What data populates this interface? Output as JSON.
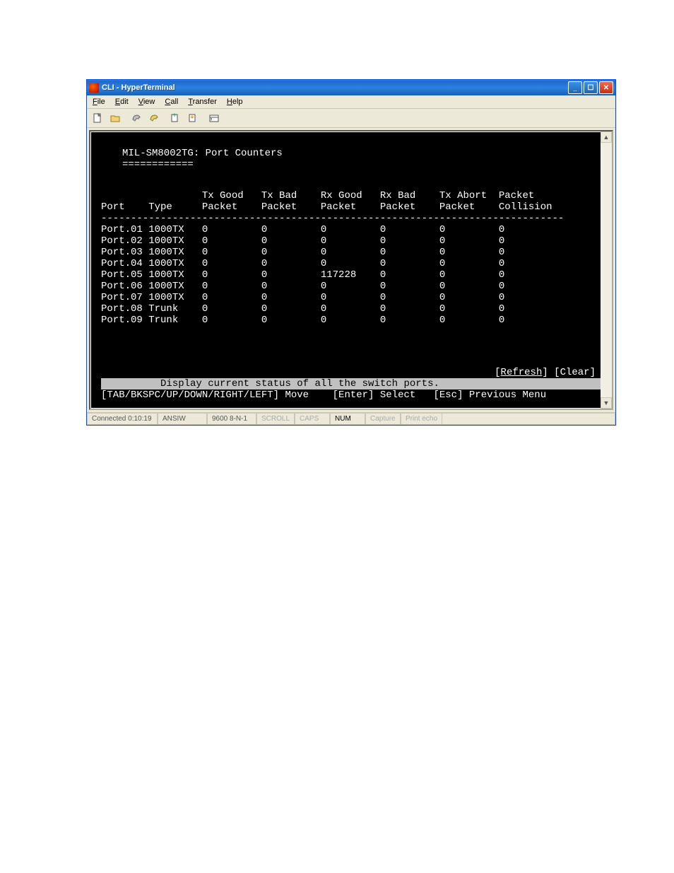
{
  "window": {
    "title": "CLI - HyperTerminal"
  },
  "menubar": [
    {
      "underline": "F",
      "rest": "ile"
    },
    {
      "underline": "E",
      "rest": "dit"
    },
    {
      "underline": "V",
      "rest": "iew"
    },
    {
      "underline": "C",
      "rest": "all"
    },
    {
      "underline": "T",
      "rest": "ransfer"
    },
    {
      "underline": "H",
      "rest": "elp"
    }
  ],
  "terminal": {
    "title": "MIL-SM8002TG: Port Counters",
    "underline": "============",
    "columns_line1": "         Tx Good   Tx Bad    Rx Good   Rx Bad    Tx Abort  Packet",
    "columns_line2": "Port    Type     Packet    Packet    Packet    Packet    Packet    Collision",
    "divider": "------------------------------------------------------------------------------",
    "rows": [
      {
        "port": "Port.01",
        "type": "1000TX",
        "c": [
          "0",
          "0",
          "0",
          "0",
          "0",
          "0"
        ]
      },
      {
        "port": "Port.02",
        "type": "1000TX",
        "c": [
          "0",
          "0",
          "0",
          "0",
          "0",
          "0"
        ]
      },
      {
        "port": "Port.03",
        "type": "1000TX",
        "c": [
          "0",
          "0",
          "0",
          "0",
          "0",
          "0"
        ]
      },
      {
        "port": "Port.04",
        "type": "1000TX",
        "c": [
          "0",
          "0",
          "0",
          "0",
          "0",
          "0"
        ]
      },
      {
        "port": "Port.05",
        "type": "1000TX",
        "c": [
          "0",
          "0",
          "117228",
          "0",
          "0",
          "0"
        ]
      },
      {
        "port": "Port.06",
        "type": "1000TX",
        "c": [
          "0",
          "0",
          "0",
          "0",
          "0",
          "0"
        ]
      },
      {
        "port": "Port.07",
        "type": "1000TX",
        "c": [
          "0",
          "0",
          "0",
          "0",
          "0",
          "0"
        ]
      },
      {
        "port": "Port.08",
        "type": "Trunk ",
        "c": [
          "0",
          "0",
          "0",
          "0",
          "0",
          "0"
        ]
      },
      {
        "port": "Port.09",
        "type": "Trunk ",
        "c": [
          "0",
          "0",
          "0",
          "0",
          "0",
          "0"
        ]
      }
    ],
    "refresh_label": "Refresh",
    "clear_label": "Clear",
    "help_line": "         Display current status of all the switch ports.         ",
    "nav_line": "[TAB/BKSPC/UP/DOWN/RIGHT/LEFT] Move    [Enter] Select   [Esc] Previous Menu"
  },
  "statusbar": {
    "connected": "Connected 0:10:19",
    "encoding": "ANSIW",
    "settings": "9600 8-N-1",
    "scroll": "SCROLL",
    "caps": "CAPS",
    "num": "NUM",
    "capture": "Capture",
    "printecho": "Print echo"
  }
}
